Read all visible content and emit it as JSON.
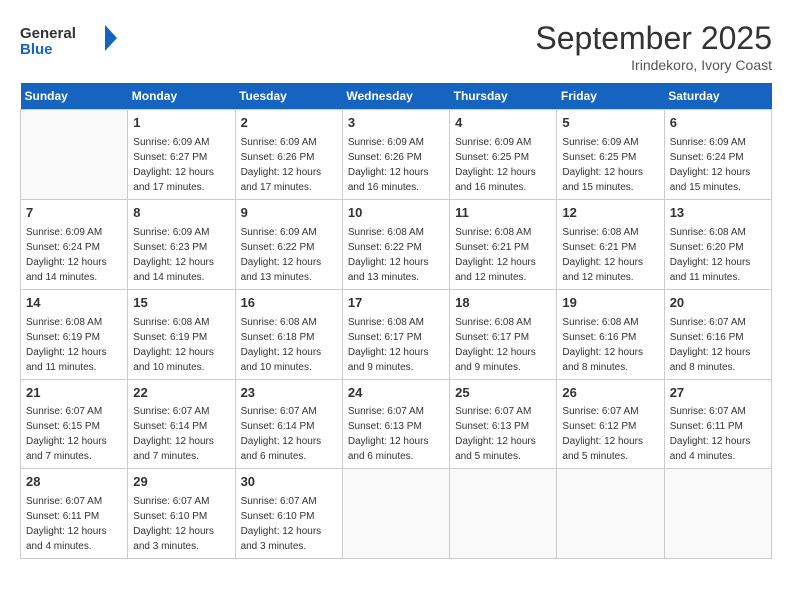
{
  "header": {
    "logo_line1": "General",
    "logo_line2": "Blue",
    "month_title": "September 2025",
    "subtitle": "Irindekoro, Ivory Coast"
  },
  "weekdays": [
    "Sunday",
    "Monday",
    "Tuesday",
    "Wednesday",
    "Thursday",
    "Friday",
    "Saturday"
  ],
  "weeks": [
    [
      {
        "day": "",
        "info": ""
      },
      {
        "day": "1",
        "info": "Sunrise: 6:09 AM\nSunset: 6:27 PM\nDaylight: 12 hours\nand 17 minutes."
      },
      {
        "day": "2",
        "info": "Sunrise: 6:09 AM\nSunset: 6:26 PM\nDaylight: 12 hours\nand 17 minutes."
      },
      {
        "day": "3",
        "info": "Sunrise: 6:09 AM\nSunset: 6:26 PM\nDaylight: 12 hours\nand 16 minutes."
      },
      {
        "day": "4",
        "info": "Sunrise: 6:09 AM\nSunset: 6:25 PM\nDaylight: 12 hours\nand 16 minutes."
      },
      {
        "day": "5",
        "info": "Sunrise: 6:09 AM\nSunset: 6:25 PM\nDaylight: 12 hours\nand 15 minutes."
      },
      {
        "day": "6",
        "info": "Sunrise: 6:09 AM\nSunset: 6:24 PM\nDaylight: 12 hours\nand 15 minutes."
      }
    ],
    [
      {
        "day": "7",
        "info": ""
      },
      {
        "day": "8",
        "info": "Sunrise: 6:09 AM\nSunset: 6:23 PM\nDaylight: 12 hours\nand 14 minutes."
      },
      {
        "day": "9",
        "info": "Sunrise: 6:09 AM\nSunset: 6:22 PM\nDaylight: 12 hours\nand 13 minutes."
      },
      {
        "day": "10",
        "info": "Sunrise: 6:08 AM\nSunset: 6:22 PM\nDaylight: 12 hours\nand 13 minutes."
      },
      {
        "day": "11",
        "info": "Sunrise: 6:08 AM\nSunset: 6:21 PM\nDaylight: 12 hours\nand 12 minutes."
      },
      {
        "day": "12",
        "info": "Sunrise: 6:08 AM\nSunset: 6:21 PM\nDaylight: 12 hours\nand 12 minutes."
      },
      {
        "day": "13",
        "info": "Sunrise: 6:08 AM\nSunset: 6:20 PM\nDaylight: 12 hours\nand 11 minutes."
      }
    ],
    [
      {
        "day": "14",
        "info": ""
      },
      {
        "day": "15",
        "info": "Sunrise: 6:08 AM\nSunset: 6:19 PM\nDaylight: 12 hours\nand 10 minutes."
      },
      {
        "day": "16",
        "info": "Sunrise: 6:08 AM\nSunset: 6:18 PM\nDaylight: 12 hours\nand 10 minutes."
      },
      {
        "day": "17",
        "info": "Sunrise: 6:08 AM\nSunset: 6:17 PM\nDaylight: 12 hours\nand 9 minutes."
      },
      {
        "day": "18",
        "info": "Sunrise: 6:08 AM\nSunset: 6:17 PM\nDaylight: 12 hours\nand 9 minutes."
      },
      {
        "day": "19",
        "info": "Sunrise: 6:08 AM\nSunset: 6:16 PM\nDaylight: 12 hours\nand 8 minutes."
      },
      {
        "day": "20",
        "info": "Sunrise: 6:07 AM\nSunset: 6:16 PM\nDaylight: 12 hours\nand 8 minutes."
      }
    ],
    [
      {
        "day": "21",
        "info": ""
      },
      {
        "day": "22",
        "info": "Sunrise: 6:07 AM\nSunset: 6:14 PM\nDaylight: 12 hours\nand 7 minutes."
      },
      {
        "day": "23",
        "info": "Sunrise: 6:07 AM\nSunset: 6:14 PM\nDaylight: 12 hours\nand 6 minutes."
      },
      {
        "day": "24",
        "info": "Sunrise: 6:07 AM\nSunset: 6:13 PM\nDaylight: 12 hours\nand 6 minutes."
      },
      {
        "day": "25",
        "info": "Sunrise: 6:07 AM\nSunset: 6:13 PM\nDaylight: 12 hours\nand 5 minutes."
      },
      {
        "day": "26",
        "info": "Sunrise: 6:07 AM\nSunset: 6:12 PM\nDaylight: 12 hours\nand 5 minutes."
      },
      {
        "day": "27",
        "info": "Sunrise: 6:07 AM\nSunset: 6:11 PM\nDaylight: 12 hours\nand 4 minutes."
      }
    ],
    [
      {
        "day": "28",
        "info": "Sunrise: 6:07 AM\nSunset: 6:11 PM\nDaylight: 12 hours\nand 4 minutes."
      },
      {
        "day": "29",
        "info": "Sunrise: 6:07 AM\nSunset: 6:10 PM\nDaylight: 12 hours\nand 3 minutes."
      },
      {
        "day": "30",
        "info": "Sunrise: 6:07 AM\nSunset: 6:10 PM\nDaylight: 12 hours\nand 3 minutes."
      },
      {
        "day": "",
        "info": ""
      },
      {
        "day": "",
        "info": ""
      },
      {
        "day": "",
        "info": ""
      },
      {
        "day": "",
        "info": ""
      }
    ]
  ],
  "week7_day7_note": "Sunrise: 6:09 AM\nSunset: 6:24 PM\nDaylight: 12 hours\nand 14 minutes.",
  "week3_day1_note": "Sunrise: 6:08 AM\nSunset: 6:19 PM\nDaylight: 12 hours\nand 11 minutes.",
  "week4_day1_note": "Sunrise: 6:07 AM\nSunset: 6:15 PM\nDaylight: 12 hours\nand 7 minutes."
}
